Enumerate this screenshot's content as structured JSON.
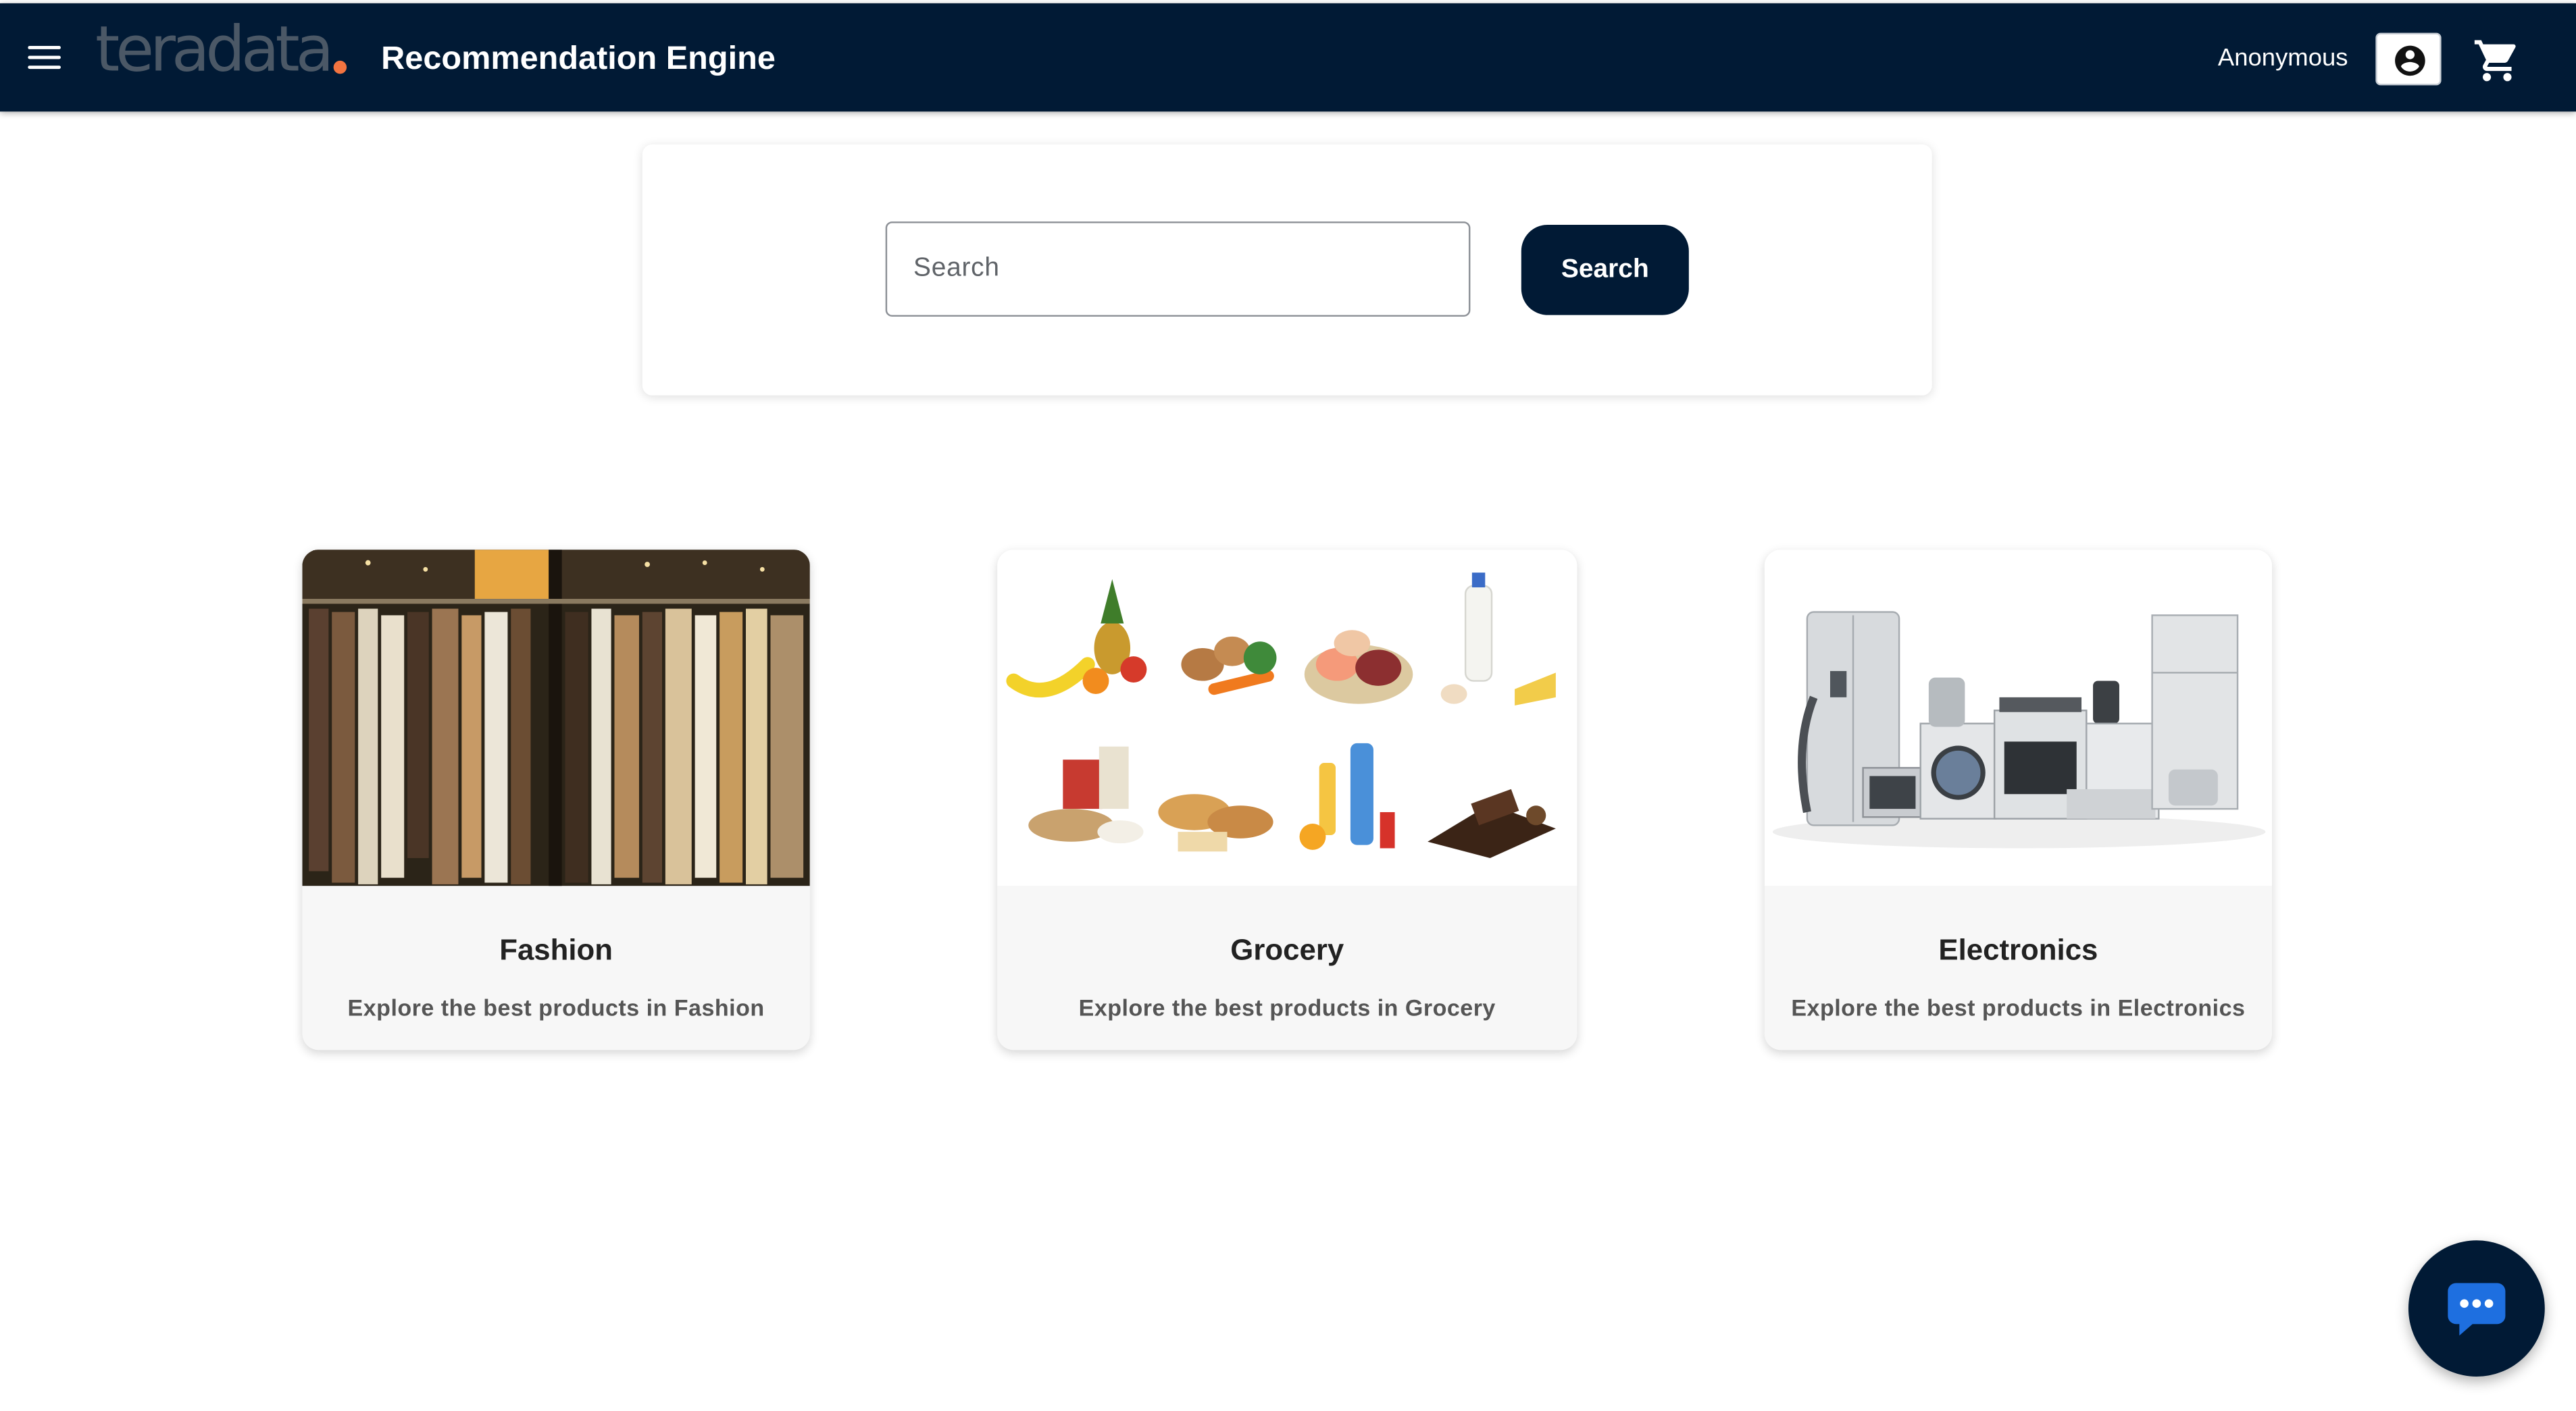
{
  "header": {
    "logo_text": "teradata",
    "app_title": "Recommendation Engine",
    "user_name": "Anonymous",
    "icons": [
      "menu-icon",
      "account-circle-icon",
      "shopping-cart-icon"
    ]
  },
  "search": {
    "placeholder": "Search",
    "value": "",
    "button_label": "Search"
  },
  "categories": [
    {
      "title": "Fashion",
      "description": "Explore the best products in Fashion",
      "image": "clothes-rack-photo"
    },
    {
      "title": "Grocery",
      "description": "Explore the best products in Grocery",
      "image": "groceries-collage-photo"
    },
    {
      "title": "Electronics",
      "description": "Explore the best products in Electronics",
      "image": "home-appliances-photo"
    }
  ],
  "chat": {
    "icon": "chat-bubble-icon"
  },
  "colors": {
    "header_bg": "#011a35",
    "logo_text": "#4b5866",
    "logo_dot": "#f37440",
    "primary_button": "#011a35",
    "chat_bubble": "#1e6fe0",
    "card_bg": "#f7f7f7"
  }
}
